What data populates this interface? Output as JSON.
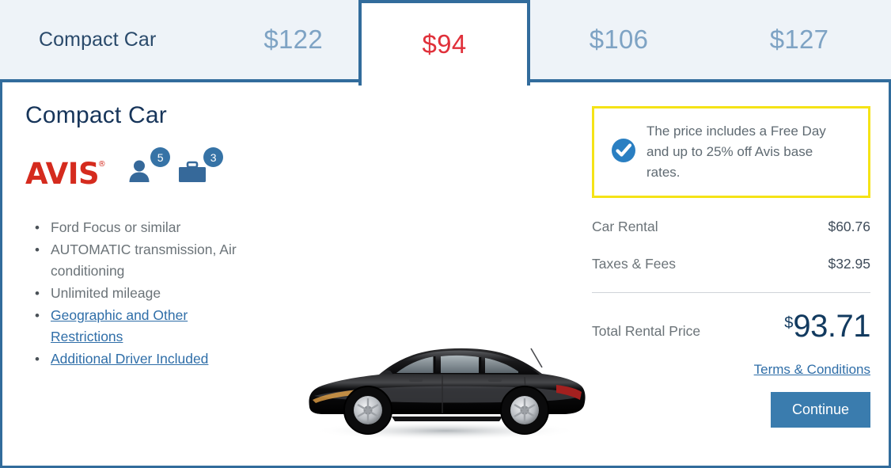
{
  "tabs": [
    {
      "name": "Compact Car",
      "price": "$122",
      "active": false
    },
    {
      "name": "",
      "price": "$94",
      "active": true
    },
    {
      "name": "",
      "price": "$106",
      "active": false
    },
    {
      "name": "",
      "price": "$127",
      "active": false
    }
  ],
  "vehicle": {
    "title": "Compact Car",
    "brand": "AVIS",
    "brand_mark": "®",
    "passengers": "5",
    "luggage": "3",
    "features": [
      {
        "text": "Ford Focus or similar",
        "link": false
      },
      {
        "text": "AUTOMATIC transmission, Air conditioning",
        "link": false
      },
      {
        "text": "Unlimited mileage",
        "link": false
      },
      {
        "text": "Geographic and Other Restrictions",
        "link": true
      },
      {
        "text": "Additional Driver Included",
        "link": true
      }
    ]
  },
  "promo": {
    "text": "The price includes a Free Day and up to 25% off Avis base rates.",
    "border_color": "#f5e316",
    "icon_color": "#2a7fc2"
  },
  "pricing": {
    "rows": [
      {
        "label": "Car Rental",
        "value": "$60.76"
      },
      {
        "label": "Taxes & Fees",
        "value": "$32.95"
      }
    ],
    "total_label": "Total Rental Price",
    "total_currency": "$",
    "total_amount": "93.71"
  },
  "actions": {
    "terms_label": "Terms & Conditions",
    "continue_label": "Continue"
  },
  "colors": {
    "accent_blue": "#326c9c",
    "tab_bg": "#eef3f8",
    "active_price_red": "#e0303a",
    "inactive_price": "#7ea3c4",
    "avis_red": "#d52b1e",
    "button_blue": "#3a7cae"
  }
}
